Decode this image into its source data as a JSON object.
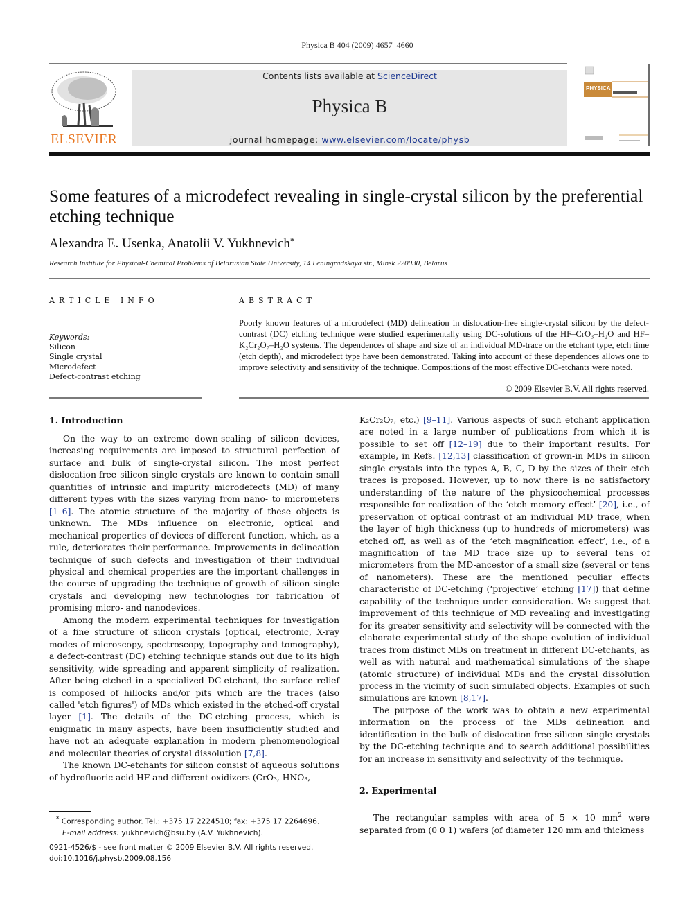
{
  "running_head": "Physica B 404 (2009) 4657–4660",
  "masthead": {
    "publisher_logo_text": "ELSEVIER",
    "contents_prefix": "Contents lists available at ",
    "contents_link": "ScienceDirect",
    "journal_title": "Physica B",
    "homepage_prefix": "journal homepage: ",
    "homepage_link": "www.elsevier.com/locate/physb",
    "cover_label": "PHYSICA",
    "colors": {
      "elsevier_orange": "#e87722",
      "link_blue": "#1f3a93",
      "masthead_bg": "#e6e6e6"
    }
  },
  "article": {
    "title": "Some features of a microdefect revealing in single-crystal silicon by the preferential etching technique",
    "authors": "Alexandra E. Usenka, Anatolii V. Yukhnevich",
    "author_mark": "*",
    "affiliation": "Research Institute for Physical-Chemical Problems of Belarusian State University, 14 Leningradskaya str., Minsk 220030, Belarus"
  },
  "article_info": {
    "heading": "ARTICLE INFO",
    "keywords_label": "Keywords:",
    "keywords": [
      "Silicon",
      "Single crystal",
      "Microdefect",
      "Defect-contrast etching"
    ]
  },
  "abstract": {
    "heading": "ABSTRACT",
    "text": "Poorly known features of a microdefect (MD) delineation in dislocation-free single-crystal silicon by the defect-contrast (DC) etching technique were studied experimentally using DC-solutions of the HF–CrO₃–H₂O and HF–K₂Cr₂O₇–H₂O systems. The dependences of shape and size of an individual MD-trace on the etchant type, etch time (etch depth), and microdefect type have been demonstrated. Taking into account of these dependences allows one to improve selectivity and sensitivity of the technique. Compositions of the most effective DC-etchants were noted.",
    "copyright": "© 2009 Elsevier B.V. All rights reserved."
  },
  "sections": {
    "intro_heading": "1.  Introduction",
    "intro_p1_a": "On the way to an extreme down-scaling of silicon devices, increasing requirements are imposed to structural perfection of surface and bulk of single-crystal silicon. The most perfect dislocation-free silicon single crystals are known to contain small quantities of intrinsic and impurity microdefects (MD) of many different types with the sizes varying from nano- to micrometers ",
    "intro_p1_ref": "[1–6]",
    "intro_p1_b": ". The atomic structure of the majority of these objects is unknown. The MDs influence on electronic, optical and mechanical properties of devices of different function, which, as a rule, deteriorates their performance. Improvements in delineation technique of such defects and investigation of their individual physical and chemical properties are the important challenges in the course of upgrading the technique of growth of silicon single crystals and developing new technologies for fabrication of promising micro- and nanodevices.",
    "intro_p2_a": "Among the modern experimental techniques for investigation of a fine structure of silicon crystals (optical, electronic, X-ray modes of microscopy, spectroscopy, topography and tomography), a defect-contrast (DC) etching technique stands out due to its high sensitivity, wide spreading and apparent simplicity of realization. After being etched in a specialized DC-etchant, the surface relief is composed of hillocks and/or pits which are the traces (also called 'etch figures') of MDs which existed in the etched-off crystal layer ",
    "intro_p2_ref1": "[1]",
    "intro_p2_b": ". The details of the DC-etching process, which is enigmatic in many aspects, have been insufficiently studied and have not an adequate explanation in modern phenomenological and molecular theories of crystal dissolution ",
    "intro_p2_ref2": "[7,8]",
    "intro_p2_c": ".",
    "intro_p3_a": "The known DC-etchants for silicon consist of aqueous solutions of hydrofluoric acid HF and different oxidizers (CrO₃, HNO₃,",
    "right_p1_a": "K₂Cr₂O₇, etc.) ",
    "right_p1_ref1": "[9–11]",
    "right_p1_b": ". Various aspects of such etchant application are noted in a large number of publications from which it is possible to set off ",
    "right_p1_ref2": "[12–19]",
    "right_p1_c": " due to their important results. For example, in Refs. ",
    "right_p1_ref3": "[12,13]",
    "right_p1_d": " classification of grown-in MDs in silicon single crystals into the types A, B, C, D by the sizes of their etch traces is proposed. However, up to now there is no satisfactory understanding of the nature of the physicochemical processes responsible for realization of the ‘etch memory effect’ ",
    "right_p1_ref4": "[20]",
    "right_p1_e": ", i.e., of preservation of optical contrast of an individual MD trace, when the layer of high thickness (up to hundreds of micrometers) was etched off, as well as of the ‘etch magnification effect’, i.e., of a magnification of the MD trace size up to several tens of micrometers from the MD-ancestor of a small size (several or tens of nanometers). These are the mentioned peculiar effects characteristic of DC-etching (‘projective’ etching ",
    "right_p1_ref5": "[17]",
    "right_p1_f": ") that define capability of the technique under consideration. We suggest that improvement of this technique of MD revealing and investigating for its greater sensitivity and selectivity will be connected with the elaborate experimental study of the shape evolution of individual traces from distinct MDs on treatment in different DC-etchants, as well as with natural and mathematical simulations of the shape (atomic structure) of individual MDs and the crystal dissolution process in the vicinity of such simulated objects. Examples of such simulations are known ",
    "right_p1_ref6": "[8,17]",
    "right_p1_g": ".",
    "right_p2": "The purpose of the work was to obtain a new experimental information on the process of the MDs delineation and identification in the bulk of dislocation-free silicon single crystals by the DC-etching technique and to search additional possibilities for an increase in sensitivity and selectivity of the technique.",
    "exp_heading": "2.  Experimental",
    "exp_p1_a": "The rectangular samples with area of 5 × 10 mm",
    "exp_p1_sup": "2",
    "exp_p1_b": " were separated from (0 0 1) wafers (of diameter 120 mm and thickness"
  },
  "footnote": {
    "mark": "*",
    "corresponding": "Corresponding author. Tel.: +375 17 2224510; fax: +375 17 2264696.",
    "email_label": "E-mail address:",
    "email": " yukhnevich@bsu.by (A.V. Yukhnevich).",
    "issn_line": "0921-4526/$ - see front matter © 2009 Elsevier B.V. All rights reserved.",
    "doi": "doi:10.1016/j.physb.2009.08.156"
  }
}
